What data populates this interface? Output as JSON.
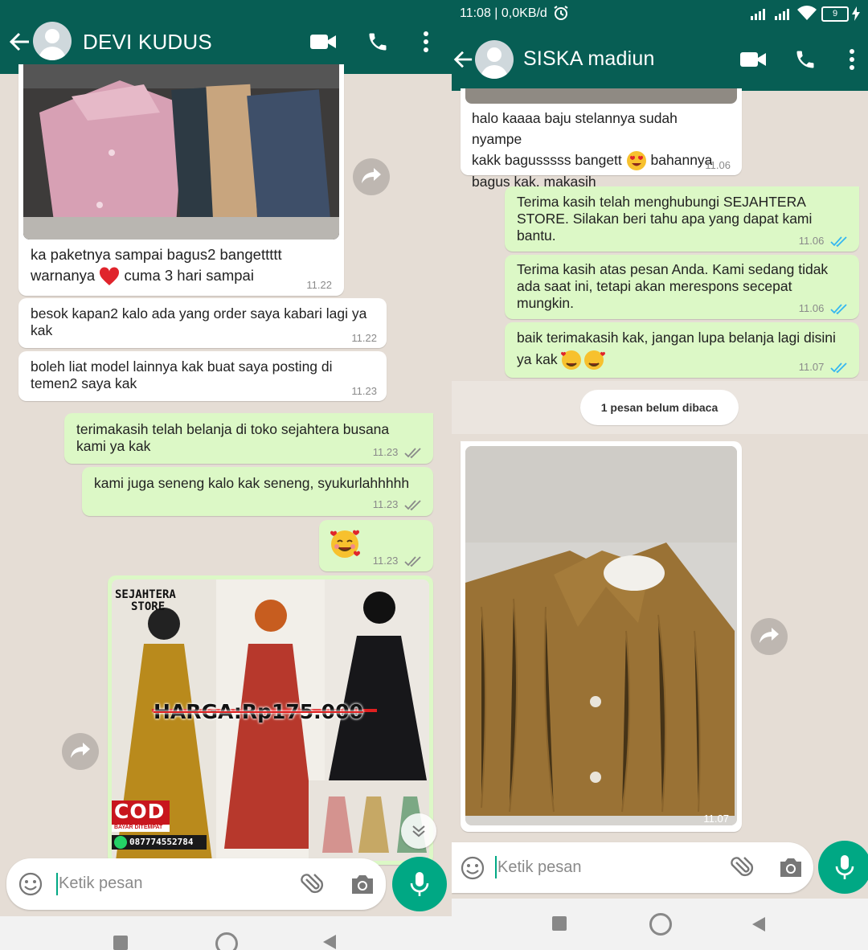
{
  "left": {
    "contact_name": "DEVI KUDUS",
    "messages": [
      {
        "dir": "in",
        "type": "image",
        "text": "ka paketnya sampai bagus2 bangettttt",
        "text2a": "warnanya",
        "text2b": "cuma 3 hari sampai",
        "time": "11.22"
      },
      {
        "dir": "in",
        "text": "besok kapan2 kalo ada yang order saya kabari lagi ya kak",
        "time": "11.22"
      },
      {
        "dir": "in",
        "text": "boleh liat model lainnya kak buat saya posting di temen2 saya kak",
        "time": "11.23"
      },
      {
        "dir": "out",
        "text": "terimakasih telah belanja di toko sejahtera busana kami ya kak",
        "time": "11.23"
      },
      {
        "dir": "out",
        "text": "kami juga seneng kalo kak seneng, syukurlahhhhh",
        "time": "11.23"
      },
      {
        "dir": "out",
        "type": "emoji",
        "time": "11.23"
      },
      {
        "dir": "out",
        "type": "image",
        "promo": {
          "store_line1": "SEJAHTERA",
          "store_line2": "STORE",
          "price": "HARGA:Rp175.000",
          "cod": "COD",
          "cod_sub": "BAYAR DITEMPAT",
          "phone": "087774552784"
        }
      }
    ],
    "input_placeholder": "Ketik pesan"
  },
  "right": {
    "status_time": "11:08 | 0,0KB/d",
    "battery": "9",
    "contact_name": "SISKA madiun",
    "messages": [
      {
        "dir": "in",
        "text1": "halo kaaaa baju stelannya sudah nyampe",
        "text2a": "kakk bagusssss bangett",
        "text2b": "bahannya",
        "text3": "bagus kak, makasih",
        "time": "11.06"
      },
      {
        "dir": "out",
        "text": "Terima kasih telah menghubungi SEJAHTERA STORE. Silakan beri tahu apa yang dapat kami bantu.",
        "time": "11.06"
      },
      {
        "dir": "out",
        "text": "Terima kasih atas pesan Anda. Kami sedang tidak ada saat ini, tetapi akan merespons secepat mungkin.",
        "time": "11.06"
      },
      {
        "dir": "out",
        "text1": "baik terimakasih kak, jangan lupa belanja lagi disini",
        "text2": "ya kak",
        "time": "11.07"
      },
      {
        "dir": "in",
        "type": "image",
        "time": "11.07"
      }
    ],
    "unread_label": "1 pesan belum dibaca",
    "input_placeholder": "Ketik pesan"
  },
  "colors": {
    "header": "#075e54",
    "out_bubble": "#dcf8c6",
    "in_bubble": "#ffffff",
    "wallpaper": "#e5ddd5",
    "mic": "#00a884",
    "read_ticks": "#34b7f1"
  }
}
